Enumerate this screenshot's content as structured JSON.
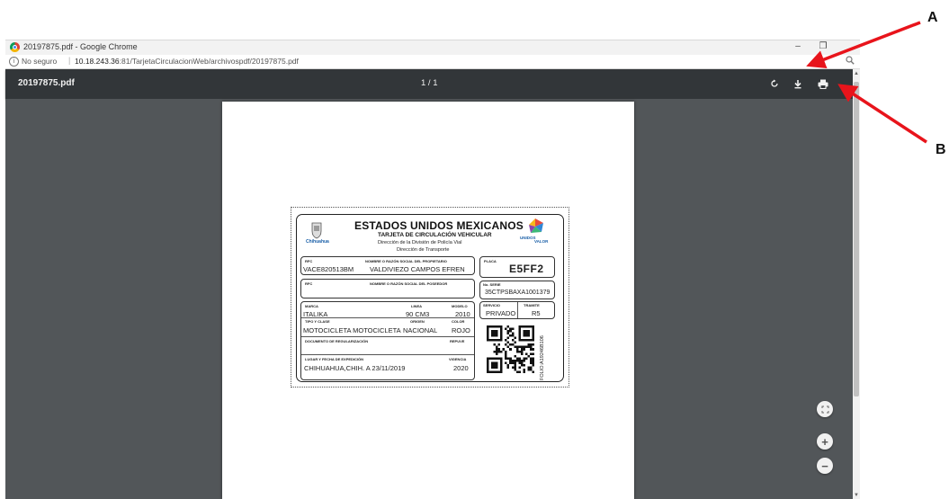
{
  "window": {
    "title": "20197875.pdf - Google Chrome",
    "minimize": "–",
    "restore": "❐"
  },
  "address": {
    "info_glyph": "i",
    "security": "No seguro",
    "separator": "|",
    "host": "10.18.243.36",
    "rest": ":81/TarjetaCirculacionWeb/archivospdf/20197875.pdf"
  },
  "toolbar": {
    "filename": "20197875.pdf",
    "page_indicator": "1 / 1",
    "rotate_icon": "rotate-icon",
    "download_icon": "download-icon",
    "print_icon": "print-icon"
  },
  "card": {
    "title": "ESTADOS UNIDOS MEXICANOS",
    "subtitle": "TARJETA DE CIRCULACIÓN VEHICULAR",
    "line1": "Dirección de la División de Policía Vial",
    "line2": "Dirección de Transporte",
    "state_logo_text": "Chihuahua",
    "right_logo_text_1": "UNIDOS",
    "right_logo_text_2": "VALOR",
    "rfc_label": "RFC",
    "owner_label": "NOMBRE O RAZÓN SOCIAL DEL PROPIETARIO",
    "rfc_value": "VACE820513BM",
    "owner_value": "VALDIVIEZO CAMPOS EFREN",
    "placa_label": "PLACA",
    "placa_value": "E5FF2",
    "rfc2_label": "RFC",
    "holder_label": "NOMBRE O RAZÓN SOCIAL DEL POSEEDOR",
    "serie_label": "No. SERIE",
    "serie_value": "35CTPSBAXA1001379",
    "marca_label": "MARCA",
    "linea_label": "LINEA",
    "modelo_label": "MODELO",
    "marca_value": "ITALIKA",
    "linea_value": "90 CM3",
    "modelo_value": "2010",
    "servicio_label": "SERVICIO",
    "tramite_label": "TRAMITE",
    "servicio_value": "PRIVADO",
    "tramite_value": "R5",
    "tipo_label": "TIPO Y CLASE",
    "origen_label": "ORIGEN",
    "color_label": "COLOR",
    "tipo_value": "MOTOCICLETA MOTOCICLETA",
    "origen_value": "NACIONAL",
    "color_value": "ROJO",
    "doc_label": "DOCUMENTO DE REGULARIZACIÓN",
    "repuve_label": "REPUVE",
    "lugar_label": "LUGAR Y FECHA DE EXPEDICIÓN",
    "vigencia_label": "VIGENCIA",
    "lugar_value": "CHIHUAHUA,CHIH. A 23/11/2019",
    "vigencia_value": "2020",
    "folio": "FOLIO:A19246B106"
  },
  "annotations": {
    "a": "A",
    "b": "B"
  },
  "zoom": {
    "fit": "fit-to-page-icon",
    "plus": "+",
    "minus": "−"
  },
  "colors": {
    "toolbar_bg": "#323639",
    "viewer_bg": "#525659",
    "arrow": "#e8141b"
  }
}
